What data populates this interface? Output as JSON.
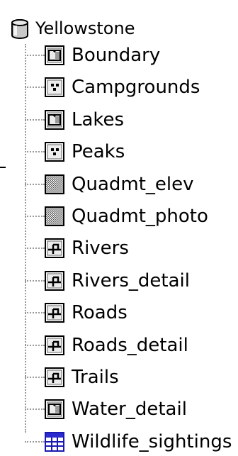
{
  "tree": {
    "root": {
      "label": "Yellowstone",
      "icon": "database-icon"
    },
    "items": [
      {
        "label": "Boundary",
        "icon": "polygon-layer-icon"
      },
      {
        "label": "Campgrounds",
        "icon": "point-layer-icon"
      },
      {
        "label": "Lakes",
        "icon": "polygon-layer-icon"
      },
      {
        "label": "Peaks",
        "icon": "point-layer-icon"
      },
      {
        "label": "Quadmt_elev",
        "icon": "raster-layer-icon"
      },
      {
        "label": "Quadmt_photo",
        "icon": "raster-layer-icon"
      },
      {
        "label": "Rivers",
        "icon": "line-layer-icon"
      },
      {
        "label": "Rivers_detail",
        "icon": "line-layer-icon"
      },
      {
        "label": "Roads",
        "icon": "line-layer-icon"
      },
      {
        "label": "Roads_detail",
        "icon": "line-layer-icon"
      },
      {
        "label": "Trails",
        "icon": "line-layer-icon"
      },
      {
        "label": "Water_detail",
        "icon": "polygon-layer-icon"
      },
      {
        "label": "Wildlife_sightings",
        "icon": "table-icon"
      }
    ]
  }
}
